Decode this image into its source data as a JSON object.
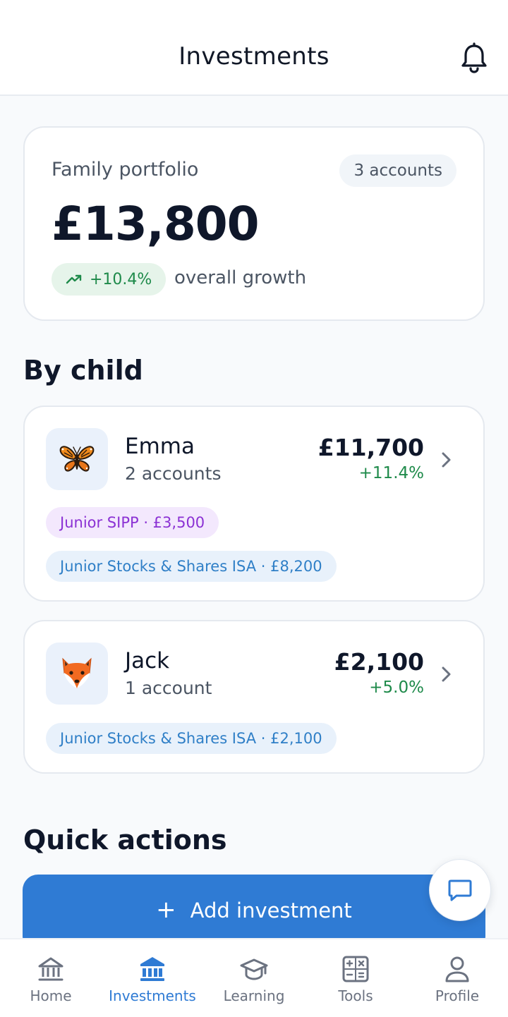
{
  "header": {
    "title": "Investments"
  },
  "portfolio": {
    "label": "Family portfolio",
    "accounts_badge": "3 accounts",
    "amount": "£13,800",
    "growth": "+10.4%",
    "growth_text": "overall growth"
  },
  "by_child": {
    "title": "By child",
    "children": [
      {
        "name": "Emma",
        "accounts": "2 accounts",
        "value": "£11,700",
        "growth": "+11.4%",
        "avatar_icon": "butterfly-icon",
        "pills": [
          "Junior SIPP · £3,500",
          "Junior Stocks & Shares ISA · £8,200"
        ]
      },
      {
        "name": "Jack",
        "accounts": "1 account",
        "value": "£2,100",
        "growth": "+5.0%",
        "avatar_icon": "fox-icon",
        "pills": [
          "Junior Stocks & Shares ISA · £2,100"
        ]
      }
    ]
  },
  "quick_actions": {
    "title": "Quick actions",
    "add_investment_label": "Add investment"
  },
  "nav": {
    "items": [
      {
        "label": "Home",
        "icon": "bank-outline-icon"
      },
      {
        "label": "Investments",
        "icon": "bank-filled-icon",
        "active": true
      },
      {
        "label": "Learning",
        "icon": "graduation-cap-icon"
      },
      {
        "label": "Tools",
        "icon": "calculator-icon"
      },
      {
        "label": "Profile",
        "icon": "person-icon"
      }
    ]
  },
  "colors": {
    "accent": "#2f7bd4",
    "positive": "#1e8a4a",
    "sipp_text": "#8b31d4",
    "isa_text": "#2f7fc7",
    "text_primary": "#0f172a",
    "text_secondary": "#4b5563"
  }
}
